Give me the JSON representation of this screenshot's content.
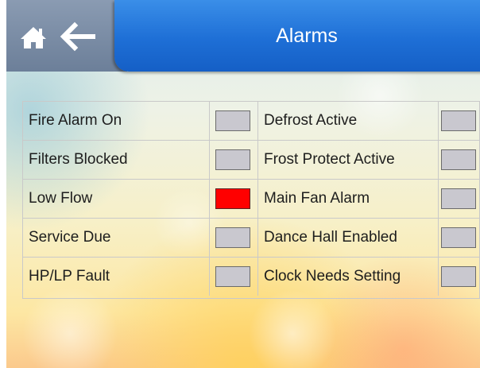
{
  "header": {
    "title": "Alarms",
    "home_icon": "home-icon",
    "back_icon": "arrow-left-icon",
    "colors": {
      "nav_bg": "#7a8ca6",
      "title_bg": "#1e6fd6"
    }
  },
  "alarms": {
    "rows": [
      {
        "left": {
          "label": "Fire Alarm On",
          "active": false
        },
        "right": {
          "label": "Defrost Active",
          "active": false
        }
      },
      {
        "left": {
          "label": "Filters Blocked",
          "active": false
        },
        "right": {
          "label": "Frost Protect Active",
          "active": false
        }
      },
      {
        "left": {
          "label": "Low Flow",
          "active": true
        },
        "right": {
          "label": "Main Fan Alarm",
          "active": false
        }
      },
      {
        "left": {
          "label": "Service Due",
          "active": false
        },
        "right": {
          "label": "Dance Hall Enabled",
          "active": false
        }
      },
      {
        "left": {
          "label": "HP/LP Fault",
          "active": false
        },
        "right": {
          "label": "Clock Needs Setting",
          "active": false
        }
      }
    ],
    "colors": {
      "inactive": "#c9c8cf",
      "active": "#ff0000"
    }
  }
}
